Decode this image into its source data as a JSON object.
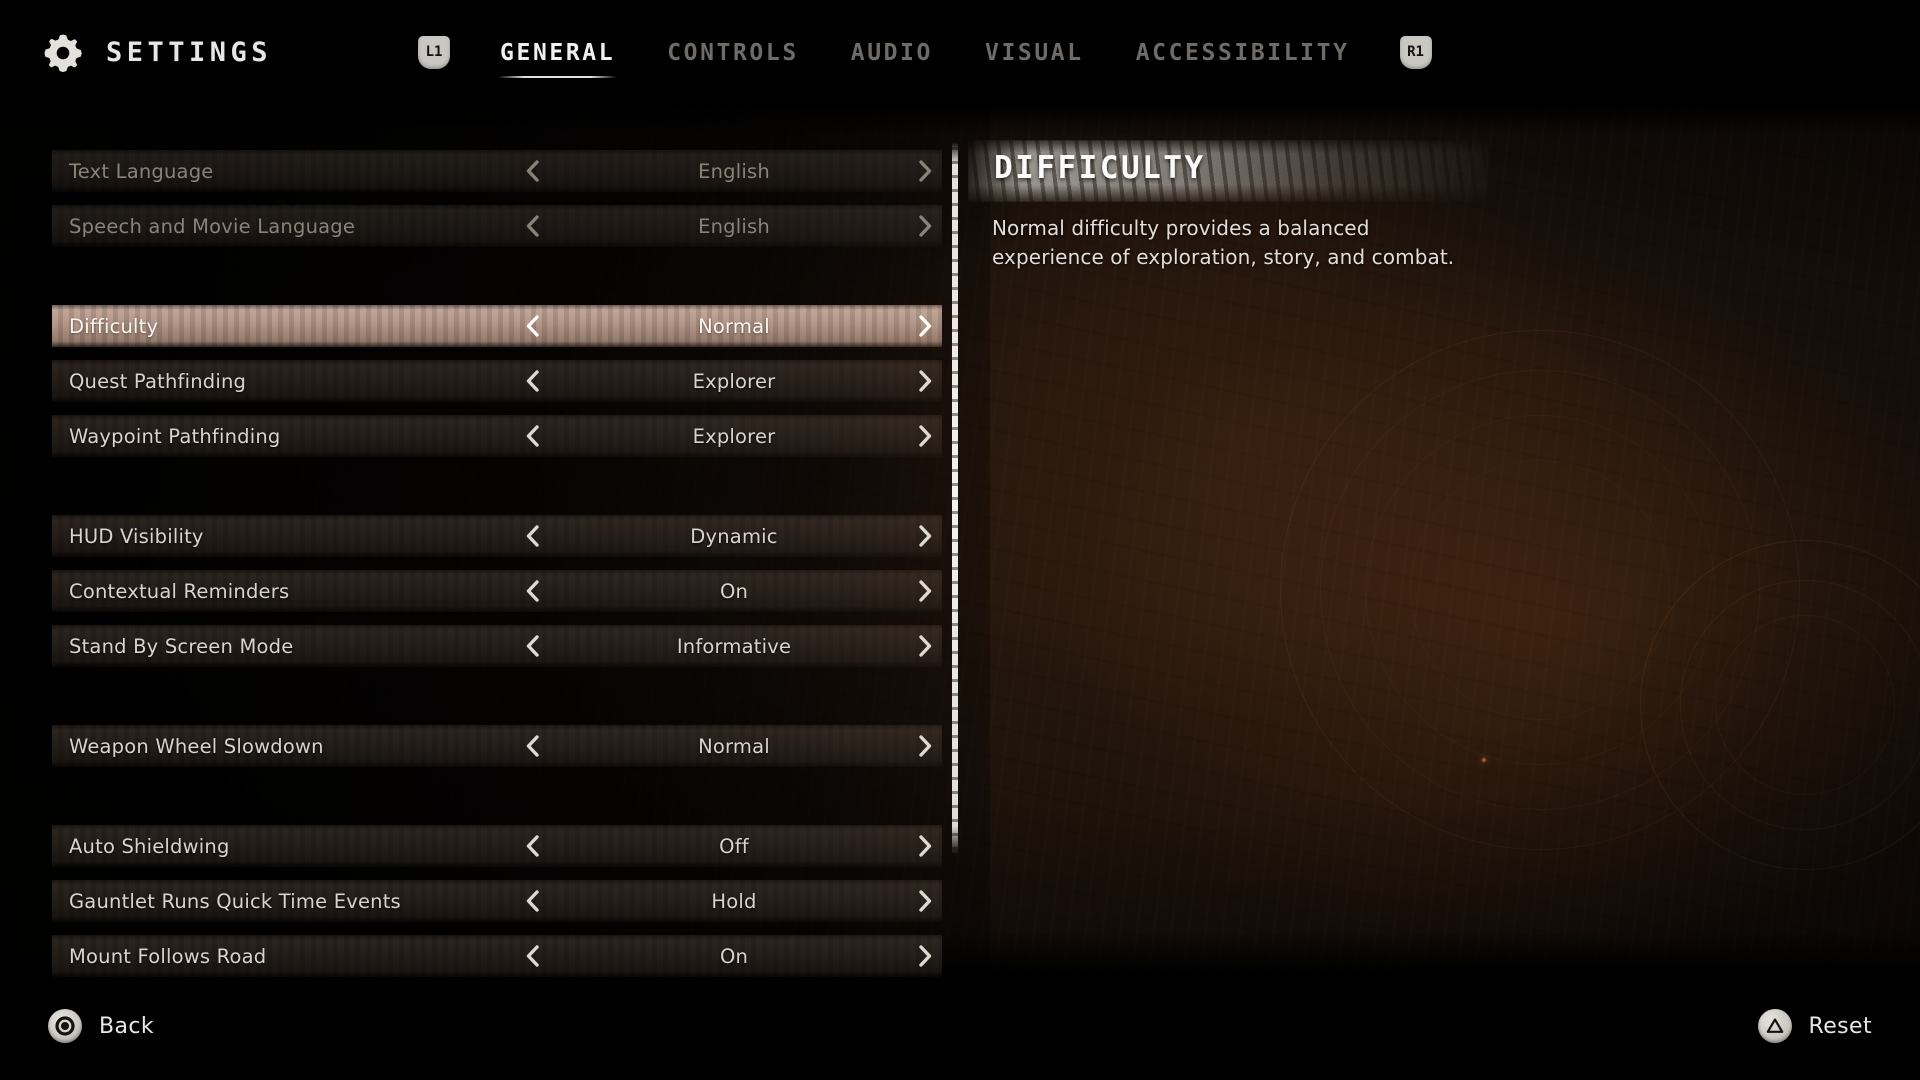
{
  "header": {
    "gear_icon": "gear-icon",
    "title": "SETTINGS",
    "left_bumper": "L1",
    "right_bumper": "R1",
    "tabs": [
      {
        "label": "GENERAL",
        "active": true
      },
      {
        "label": "CONTROLS",
        "active": false
      },
      {
        "label": "AUDIO",
        "active": false
      },
      {
        "label": "VISUAL",
        "active": false
      },
      {
        "label": "ACCESSIBILITY",
        "active": false
      }
    ]
  },
  "settings": {
    "left_arrow_icon": "chevron-left-icon",
    "right_arrow_icon": "chevron-right-icon",
    "rows": [
      {
        "label": "Text Language",
        "value": "English",
        "state": "disabled",
        "group_end": false
      },
      {
        "label": "Speech and Movie Language",
        "value": "English",
        "state": "disabled",
        "group_end": true
      },
      {
        "label": "Difficulty",
        "value": "Normal",
        "state": "selected",
        "group_end": false
      },
      {
        "label": "Quest Pathfinding",
        "value": "Explorer",
        "state": "normal",
        "group_end": false
      },
      {
        "label": "Waypoint Pathfinding",
        "value": "Explorer",
        "state": "normal",
        "group_end": true
      },
      {
        "label": "HUD Visibility",
        "value": "Dynamic",
        "state": "normal",
        "group_end": false
      },
      {
        "label": "Contextual Reminders",
        "value": "On",
        "state": "normal",
        "group_end": false
      },
      {
        "label": "Stand By Screen Mode",
        "value": "Informative",
        "state": "normal",
        "group_end": true
      },
      {
        "label": "Weapon Wheel Slowdown",
        "value": "Normal",
        "state": "normal",
        "group_end": true
      },
      {
        "label": "Auto Shieldwing",
        "value": "Off",
        "state": "normal",
        "group_end": false
      },
      {
        "label": "Gauntlet Runs Quick Time Events",
        "value": "Hold",
        "state": "normal",
        "group_end": false
      },
      {
        "label": "Mount Follows Road",
        "value": "On",
        "state": "normal",
        "group_end": false
      }
    ]
  },
  "detail": {
    "title": "DIFFICULTY",
    "description": "Normal difficulty provides a balanced experience of exploration, story, and combat."
  },
  "footer": {
    "back": {
      "label": "Back",
      "icon": "playstation-circle-icon"
    },
    "reset": {
      "label": "Reset",
      "icon": "playstation-triangle-icon"
    }
  },
  "colors": {
    "selected_row": "#bd9d8d",
    "accent_text": "#fbf8f4",
    "muted_text": "#8b8278",
    "background": "#1d130c"
  }
}
